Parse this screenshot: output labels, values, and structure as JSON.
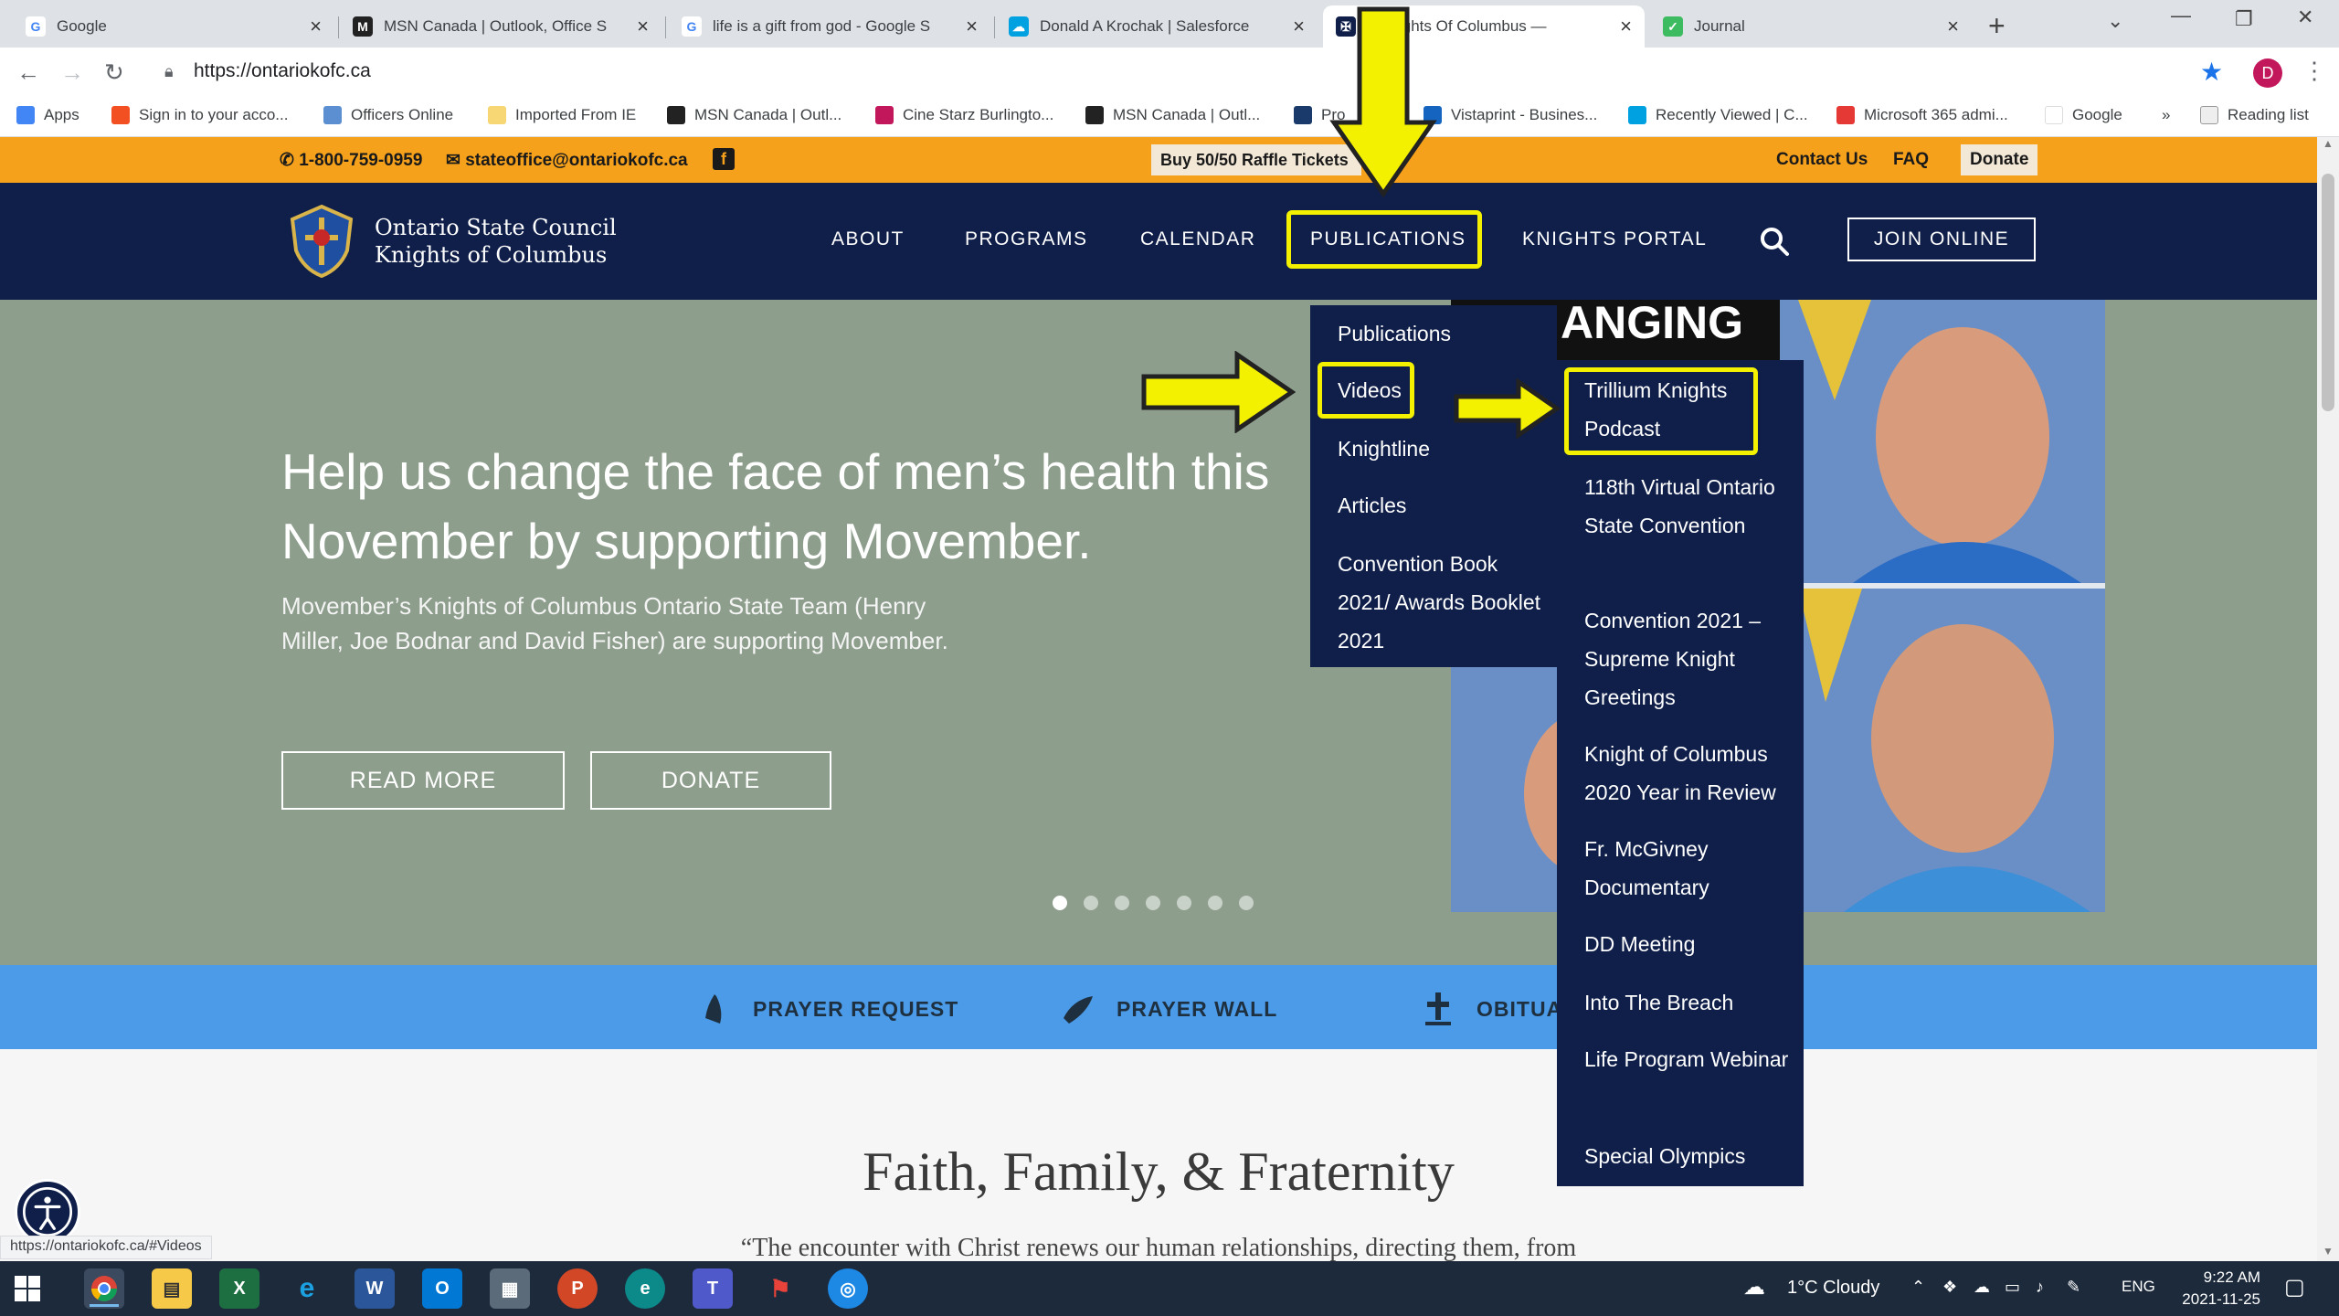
{
  "browser": {
    "tabs": [
      {
        "title": "Google",
        "icon": "google-icon"
      },
      {
        "title": "MSN Canada | Outlook, Office S",
        "icon": "msn-icon"
      },
      {
        "title": "life is a gift from god - Google S",
        "icon": "google-icon"
      },
      {
        "title": "Donald A Krochak | Salesforce",
        "icon": "salesforce-icon"
      },
      {
        "title": "n Knights Of Columbus —",
        "icon": "kofc-icon"
      },
      {
        "title": "Journal",
        "icon": "journal-icon"
      }
    ],
    "url": "https://ontariokofc.ca",
    "profile_initial": "D",
    "bookmarks": [
      "Apps",
      "Sign in to your acco...",
      "Officers Online",
      "Imported From IE",
      "MSN Canada | Outl...",
      "Cine Starz Burlingto...",
      "MSN Canada | Outl...",
      "Pro",
      "Vistaprint - Busines...",
      "Recently Viewed | C...",
      "Microsoft 365 admi...",
      "Google",
      "»",
      "Reading list"
    ]
  },
  "topbar": {
    "phone": "1-800-759-0959",
    "email": "stateoffice@ontariokofc.ca",
    "raffle": "Buy 50/50 Raffle Tickets",
    "contact": "Contact Us",
    "faq": "FAQ",
    "donate": "Donate"
  },
  "nav": {
    "logo_line1": "Ontario State Council",
    "logo_line2": "Knights of Columbus",
    "items": [
      "ABOUT",
      "PROGRAMS",
      "CALENDAR",
      "PUBLICATIONS",
      "KNIGHTS PORTAL"
    ],
    "join": "JOIN ONLINE"
  },
  "hero": {
    "title": "Help us change the face of men’s health this November by supporting Movember.",
    "subtitle": "Movember’s Knights of Columbus Ontario State Team (Henry Miller, Joe Bodnar and David Fisher) are supporting Movember.",
    "read_more": "READ MORE",
    "donate": "DONATE",
    "photo_caption": "ANGING",
    "slides": 7,
    "active_slide": 1
  },
  "publications_menu": {
    "items": [
      "Publications",
      "Videos",
      "Knightline",
      "Articles",
      "Convention Book 2021/ Awards Booklet 2021"
    ]
  },
  "videos_menu": {
    "items": [
      "Trillium Knights Podcast",
      "118th Virtual Ontario State Convention",
      "Convention 2021 – Supreme Knight Greetings",
      "Knight of Columbus 2020 Year in Review",
      "Fr. McGivney Documentary",
      "DD Meeting",
      "Into The Breach",
      "Life Program Webinar",
      "Special Olympics"
    ]
  },
  "prayer_bar": {
    "items": [
      "PRAYER REQUEST",
      "PRAYER WALL",
      "OBITUA"
    ]
  },
  "content": {
    "heading": "Faith, Family, & Fraternity",
    "quote": "“The encounter with Christ renews our human relationships, directing them, from"
  },
  "status_url": "https://ontariokofc.ca/#Videos",
  "taskbar": {
    "weather": "1°C  Cloudy",
    "lang": "ENG",
    "time": "9:22 AM",
    "date": "2021-11-25"
  },
  "colors": {
    "highlight": "#f3f000",
    "navy": "#0f1f4a",
    "orange": "#f5a11c",
    "prayer_blue": "#4c9be8"
  }
}
